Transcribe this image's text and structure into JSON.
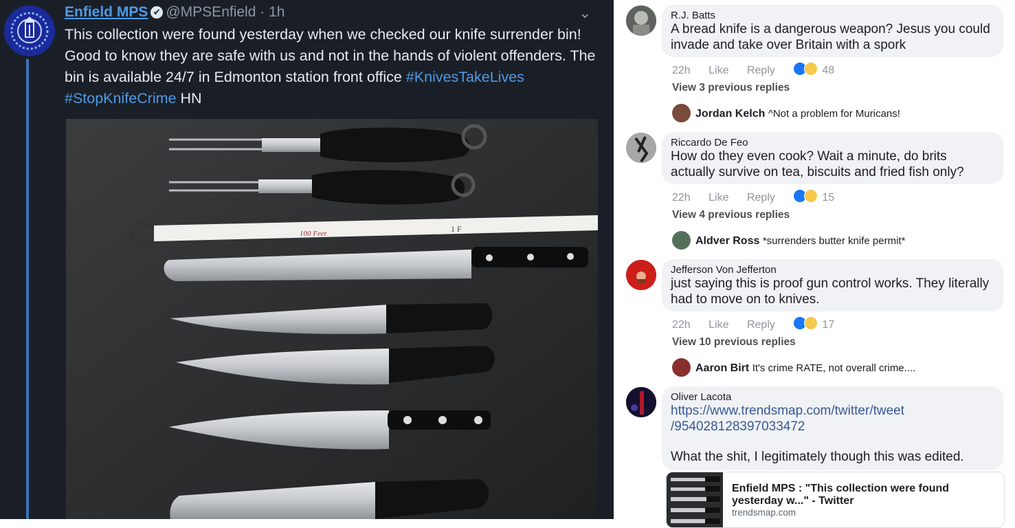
{
  "tweet": {
    "name": "Enfield MPS",
    "verified": "✔",
    "handle": "@MPSEnfield",
    "time": "· 1h",
    "text_main": "This collection were found yesterday when we checked our knife surrender bin! Good to know they are safe with us and not in the hands of violent offenders. The bin is available 24/7 in Edmonton station front office ",
    "hashtag1": "#KnivesTakeLives",
    "hashtag2": "#StopKnifeCrime",
    "text_end": " HN",
    "photo_tape": {
      "labels": [
        "100 Feet",
        "1 F"
      ]
    },
    "colors": {
      "bg": "#1a1f27",
      "link": "#4d9be6"
    }
  },
  "comments": [
    {
      "name": "R.J. Batts",
      "text": "A bread knife is a dangerous weapon? Jesus you could invade and take over Britain with a spork",
      "time": "22h",
      "like": "Like",
      "reply": "Reply",
      "reactions": "48",
      "view_replies": "View 3 previous replies",
      "reply_name": "Jordan Kelch",
      "reply_text": "^Not a problem for Muricans!"
    },
    {
      "name": "Riccardo De Feo",
      "text": "How do they even cook? Wait a minute, do brits actually survive on tea, biscuits and fried fish only?",
      "time": "22h",
      "like": "Like",
      "reply": "Reply",
      "reactions": "15",
      "view_replies": "View 4 previous replies",
      "reply_name": "Aldver Ross",
      "reply_text": "*surrenders butter knife permit*"
    },
    {
      "name": "Jefferson Von Jefferton",
      "text": "just saying this is proof gun control works. They literally had to move on to knives.",
      "time": "22h",
      "like": "Like",
      "reply": "Reply",
      "reactions": "17",
      "view_replies": "View 10 previous replies",
      "reply_name": "Aaron Birt",
      "reply_text": "It's crime RATE, not overall crime...."
    },
    {
      "name": "Oliver Lacota",
      "link": "https://www.trendsmap.com/twitter/tweet/954028128397033472",
      "link_line1": "https://www.trendsmap.com/twitter/tweet",
      "link_line2": "/954028128397033472",
      "text": "What the shit, I legitimately though this was edited.",
      "preview_title": "Enfield MPS : \"This collection were found yesterday w...\" - Twitter",
      "preview_domain": "trendsmap.com"
    }
  ]
}
